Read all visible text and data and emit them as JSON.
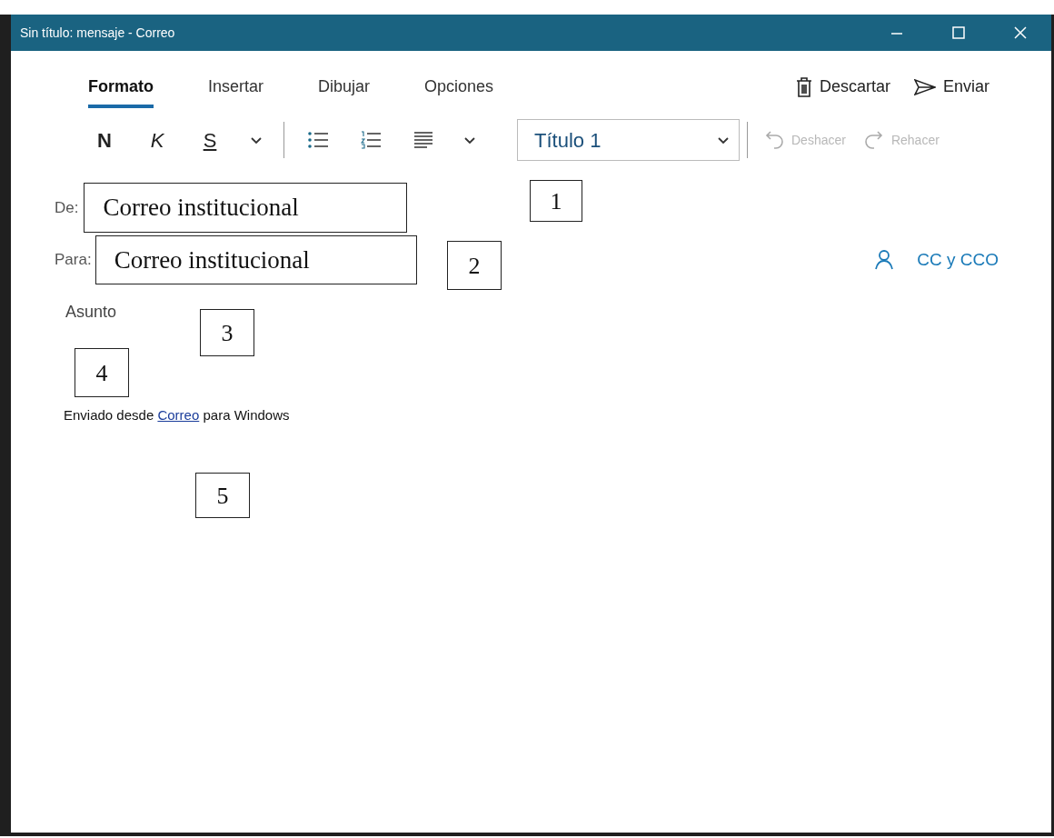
{
  "window": {
    "title": "Sin título: mensaje - Correo"
  },
  "tabs": [
    {
      "label": "Formato",
      "selected": true
    },
    {
      "label": "Insertar",
      "selected": false
    },
    {
      "label": "Dibujar",
      "selected": false
    },
    {
      "label": "Opciones",
      "selected": false
    }
  ],
  "actions": [
    {
      "kind": "discard",
      "label": "Descartar"
    },
    {
      "kind": "send",
      "label": "Enviar"
    }
  ],
  "toolbar": {
    "format_buttons": [
      {
        "kind": "bold",
        "label": "N"
      },
      {
        "kind": "italic",
        "label": "K"
      },
      {
        "kind": "underline",
        "label": "S"
      }
    ],
    "style": "Título 1",
    "history": [
      {
        "kind": "undo",
        "label": "Deshacer",
        "disabled": true
      },
      {
        "kind": "redo",
        "label": "Rehacer",
        "disabled": true
      }
    ]
  },
  "from": {
    "label": "De:",
    "value": "Correo institucional"
  },
  "to": {
    "label": "Para:",
    "value": "Correo institucional"
  },
  "cc_link": "CC y CCO",
  "subject": {
    "placeholder": "Asunto"
  },
  "signature": {
    "before": "Enviado desde",
    "link": "Correo",
    "after": "para Windows"
  },
  "callouts": [
    "1",
    "2",
    "3",
    "4",
    "5"
  ]
}
